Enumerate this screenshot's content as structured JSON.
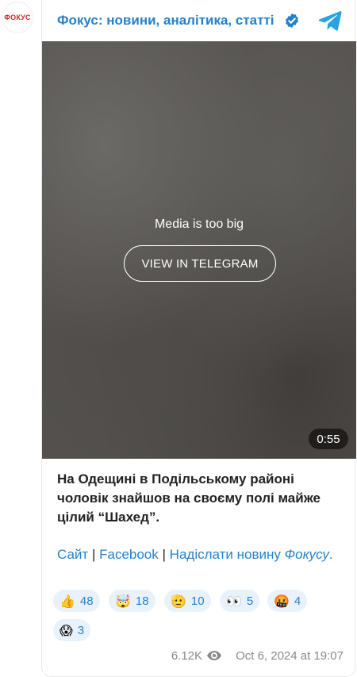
{
  "channel": {
    "avatar_text": "ФОКУС",
    "title": "Фокус: новини, аналітика, статті",
    "verified_icon": "verified-check-icon",
    "telegram_icon": "telegram-plane-icon"
  },
  "media": {
    "message": "Media is too big",
    "button_label": "VIEW IN TELEGRAM",
    "duration": "0:55"
  },
  "post": {
    "text": "На Одещині в Подільському районі чоловік знайшов на своєму полі майже цілий “Шахед”.",
    "links": {
      "site": "Сайт",
      "facebook": "Facebook",
      "send_news": "Надіслати новину",
      "fokusu": "Фокусу",
      "separator": "|",
      "period": "."
    }
  },
  "reactions": [
    {
      "emoji": "👍",
      "count": "48"
    },
    {
      "emoji": "🤯",
      "count": "18"
    },
    {
      "emoji": "🫡",
      "count": "10"
    },
    {
      "emoji": "👀",
      "count": "5"
    },
    {
      "emoji": "🤬",
      "count": "4"
    },
    {
      "emoji": "😱",
      "count": "3"
    }
  ],
  "footer": {
    "views": "6.12K",
    "datetime": "Oct 6, 2024 at 19:07"
  },
  "colors": {
    "accent": "#2481cc",
    "brand_red": "#d6232c"
  }
}
